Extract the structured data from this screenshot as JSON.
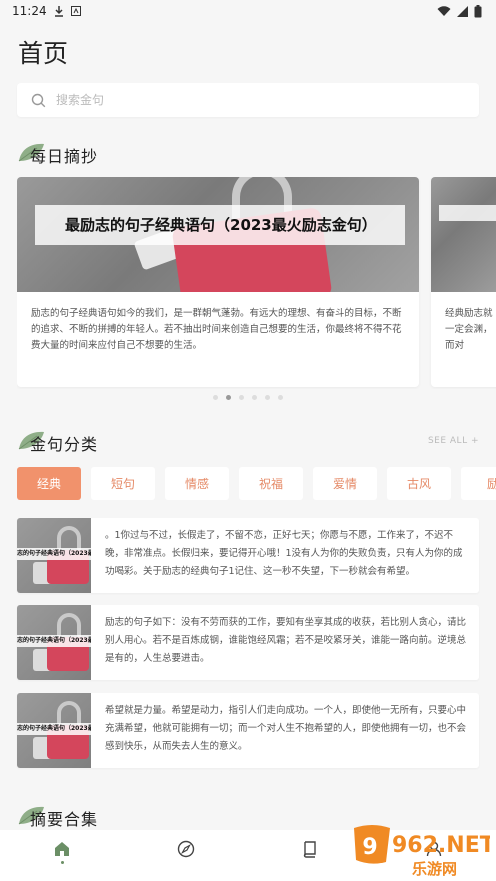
{
  "status_bar": {
    "time": "11:24"
  },
  "page_title": "首页",
  "search": {
    "placeholder": "搜索金句"
  },
  "sections": {
    "daily": "每日摘抄",
    "categories": "金句分类",
    "summary": "摘要合集",
    "see_all": "SEE ALL +"
  },
  "carousel": {
    "cards": [
      {
        "title": "最励志的句子经典语句（2023最火励志金句）",
        "text": "励志的句子经典语句如今的我们，是一群朝气蓬勃。有远大的理想、有奋斗的目标，不断的追求、不断的拼搏的年轻人。若不抽出时间来创造自己想要的生活，你最终将不得不花费大量的时间来应付自己不想要的生活。"
      },
      {
        "title": "",
        "text": "经典励志就一定会渊，而对"
      }
    ],
    "dots": 6,
    "active_dot": 1
  },
  "tabs": [
    "经典",
    "短句",
    "情感",
    "祝福",
    "爱情",
    "古风",
    "励"
  ],
  "active_tab": 0,
  "list": [
    {
      "thumb_title": "志的句子经典语句（2023最火励",
      "text": "。1你过与不过，长假走了，不留不恋，正好七天；你愿与不愿，工作来了，不迟不晚，非常准点。长假归来，要记得开心哦！1没有人为你的失败负责，只有人为你的成功喝彩。关于励志的经典句子1记住、这一秒不失望，下一秒就会有希望。"
    },
    {
      "thumb_title": "志的句子经典语句（2023最火励",
      "text": "励志的句子如下：没有不劳而获的工作，要知有坐享其成的收获，若比别人贪心，请比别人用心。若不是百炼成钢，谁能饱经风霜；若不是咬紧牙关，谁能一路向前。逆境总是有的，人生总要进击。"
    },
    {
      "thumb_title": "志的句子经典语句（2023最火励",
      "text": "希望就是力量。希望是动力，指引人们走向成功。一个人，即使他一无所有，只要心中充满希望，他就可能拥有一切；而一个对人生不抱希望的人，即使他拥有一切，也不会感到快乐，从而失去人生的意义。"
    }
  ],
  "watermark": {
    "brand": "962.NET",
    "sub": "乐游网"
  },
  "colors": {
    "accent": "#f1926c",
    "leaf": "#8fae88"
  }
}
